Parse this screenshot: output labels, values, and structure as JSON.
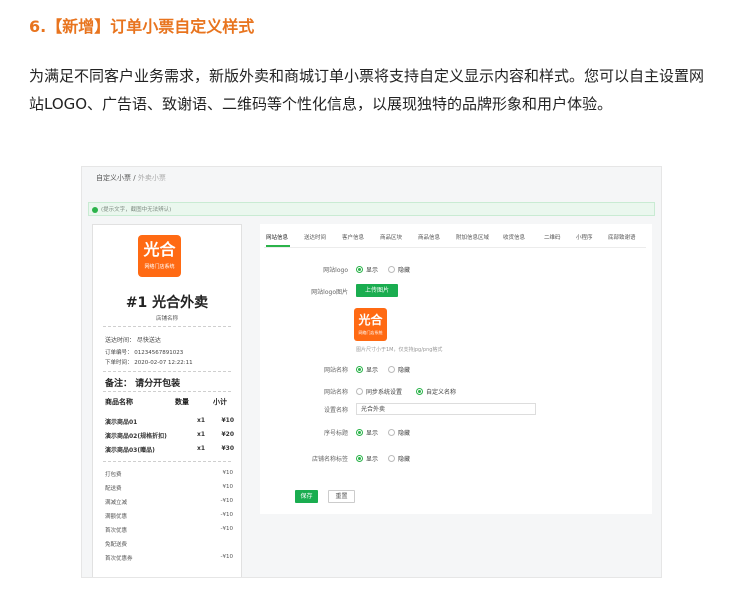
{
  "heading": "6.【新增】订单小票自定义样式",
  "paragraph": "为满足不同客户业务需求，新版外卖和商城订单小票将支持自定义显示内容和样式。您可以自主设置网站LOGO、广告语、致谢语、二维码等个性化信息，以展现独特的品牌形象和用户体验。",
  "screenshot": {
    "breadcrumb": {
      "main": "自定义小票",
      "separator": "/",
      "sub": "外卖小票"
    },
    "tip": "(提示文字，截图中无法辨认)",
    "receipt": {
      "logo_main": "光合",
      "logo_sub": "网络门店系统",
      "title": "#1 光合外卖",
      "shop_name": "店铺名称",
      "lines": [
        "送达时间：  尽快送达",
        "订单编号： 01234567891023",
        "下单时间： 2020-02-07 12:22:11"
      ],
      "note": "备注：  请分开包装",
      "columns": {
        "name": "商品名称",
        "qty": "数量",
        "subtotal": "小计"
      },
      "items": [
        {
          "name": "演示商品01",
          "qty": "x1",
          "price": "¥10"
        },
        {
          "name": "演示商品02(规格折扣)",
          "qty": "x1",
          "price": "¥20"
        },
        {
          "name": "演示商品03(赠品)",
          "qty": "x1",
          "price": "¥30"
        }
      ],
      "fees": [
        {
          "label": "打包费",
          "value": "¥10"
        },
        {
          "label": "配送费",
          "value": "¥10"
        },
        {
          "label": "满减立减",
          "value": "-¥10"
        },
        {
          "label": "满额优惠",
          "value": "-¥10"
        },
        {
          "label": "首次优惠",
          "value": "-¥10"
        },
        {
          "label": "免配送费",
          "value": ""
        },
        {
          "label": "首次优惠券",
          "value": "-¥10"
        }
      ]
    },
    "tabs": [
      "网站信息",
      "送达时间",
      "客户信息",
      "商品区块",
      "商品信息",
      "附加信息区域",
      "收货信息",
      "二维码",
      "小程序",
      "底部致谢语"
    ],
    "form": {
      "logo_label": "网站logo",
      "logo_image_label": "网站logo图片",
      "upload_button": "上传图片",
      "preview_main": "光合",
      "preview_sub": "网络门店系统",
      "upload_hint": "图片尺寸小于1M，仅支持jpg/png格式",
      "site_name_label": "网站名称",
      "name_source_label": "网站名称",
      "name_source_options": [
        "同步系统设置",
        "自定义名称"
      ],
      "custom_name_label": "设置名称",
      "custom_name_value": "光合外卖",
      "serial_label": "序号标题",
      "print_label": "店铺名称标签",
      "show": "显示",
      "hide": "隐藏",
      "save": "保存",
      "cancel": "重置"
    }
  },
  "colors": {
    "accent": "#e8741e",
    "green": "#1aad50",
    "logo": "#ff6a13"
  }
}
